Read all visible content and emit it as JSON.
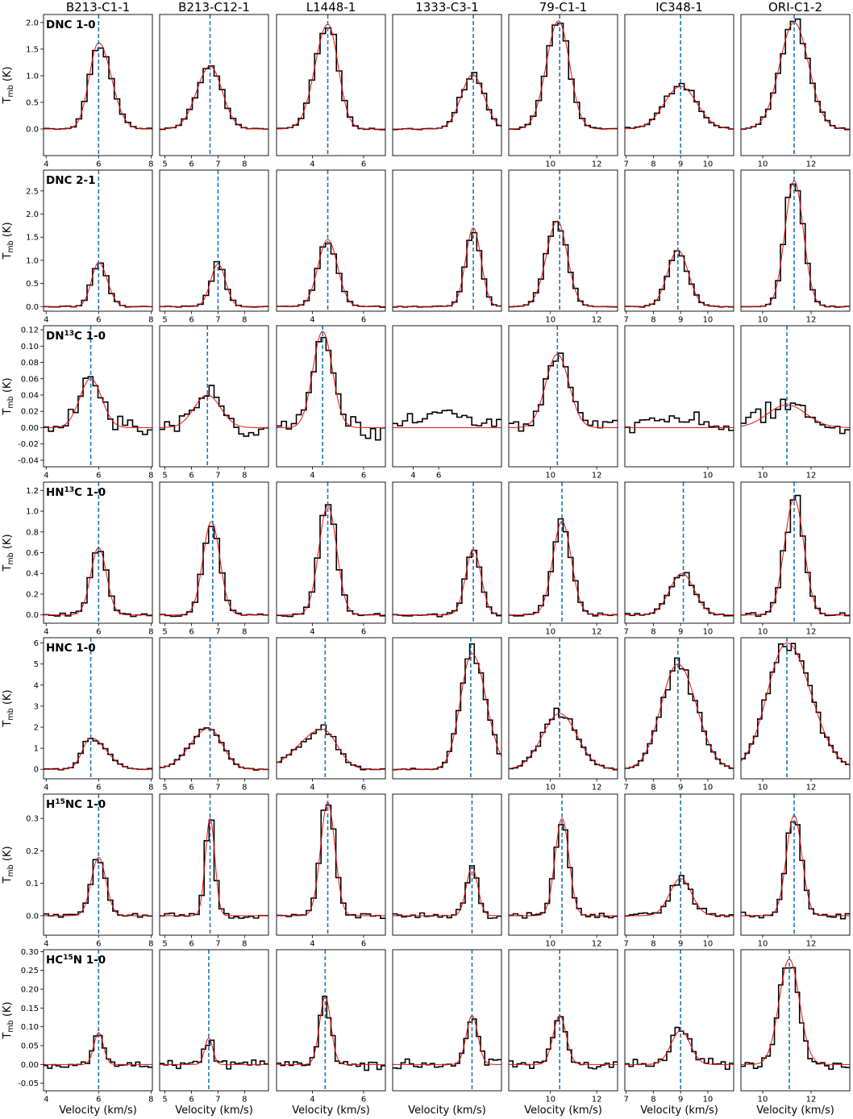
{
  "chart_data": {
    "type": "line",
    "xlabel": "Velocity (km/s)",
    "ylabel_main": "T",
    "ylabel_sub": "mb",
    "ylabel_unit": " (K)",
    "colors": {
      "observed": "#000000",
      "fit": "#e8120c",
      "vlsr": "#1f77b4"
    },
    "columns": [
      {
        "name": "B213-C1-1",
        "xlim": [
          3.9,
          8.05
        ],
        "xticks": [
          4,
          6,
          8
        ]
      },
      {
        "name": "B213-C12-1",
        "xlim": [
          4.8,
          8.9
        ],
        "xticks": [
          5,
          6,
          7,
          8
        ]
      },
      {
        "name": "L1448-1",
        "xlim": [
          2.6,
          6.85
        ],
        "xticks": [
          4,
          6
        ]
      },
      {
        "name": "1333-C3-1",
        "xlim": [
          2.4,
          10.9
        ],
        "xticks": [],
        "xticks_r5": [
          4,
          6
        ]
      },
      {
        "name": "79-C1-1",
        "xlim": [
          8.2,
          12.9
        ],
        "xticks": [
          10,
          12
        ]
      },
      {
        "name": "IC348-1",
        "xlim": [
          6.95,
          10.95
        ],
        "xticks": [
          7,
          8,
          9,
          10
        ],
        "xticks_r5": [
          10,
          12
        ]
      },
      {
        "name": "ORI-C1-2",
        "xlim": [
          9.1,
          13.6
        ],
        "xticks": [
          10,
          12
        ]
      }
    ],
    "rows": [
      {
        "line": "DNC 1-0",
        "pre": "DNC",
        "sup": "",
        "post": " 1-0",
        "ylim": [
          -0.5,
          2.15
        ],
        "yticks": [
          0.0,
          0.5,
          1.0,
          1.5,
          2.0
        ],
        "decimals": 1,
        "panels": [
          {
            "vlsr": 6.0,
            "amp": 1.62,
            "center": 6.0,
            "sigma": 0.42,
            "noise": 0.01,
            "bins": 20,
            "skew": -0.15
          },
          {
            "vlsr": 6.7,
            "amp": 1.18,
            "center": 6.7,
            "sigma": 0.48,
            "noise": 0.01,
            "bins": 20,
            "skew": 0.05
          },
          {
            "vlsr": 4.6,
            "amp": 1.97,
            "center": 4.6,
            "sigma": 0.45,
            "noise": 0.01,
            "bins": 20,
            "skew": 0.1
          },
          {
            "vlsr": 8.7,
            "amp": 1.02,
            "center": 8.65,
            "sigma": 0.9,
            "noise": 0.01,
            "bins": 22,
            "skew": 0.0
          },
          {
            "vlsr": 10.4,
            "amp": 2.03,
            "center": 10.35,
            "sigma": 0.5,
            "noise": 0.01,
            "bins": 20,
            "skew": 0.05
          },
          {
            "vlsr": 9.0,
            "amp": 0.8,
            "center": 9.0,
            "sigma": 0.6,
            "noise": 0.02,
            "bins": 22,
            "skew": 0.0
          },
          {
            "vlsr": 11.3,
            "amp": 2.0,
            "center": 11.3,
            "sigma": 0.6,
            "noise": 0.01,
            "bins": 22,
            "skew": 0.0
          }
        ]
      },
      {
        "line": "DNC 2-1",
        "pre": "DNC",
        "sup": "",
        "post": " 2-1",
        "ylim": [
          -0.1,
          2.95
        ],
        "yticks": [
          0.0,
          0.5,
          1.0,
          1.5,
          2.0,
          2.5
        ],
        "decimals": 1,
        "panels": [
          {
            "vlsr": 6.0,
            "amp": 0.95,
            "center": 6.0,
            "sigma": 0.3,
            "noise": 0.01,
            "bins": 20,
            "skew": -0.1
          },
          {
            "vlsr": 7.0,
            "amp": 0.92,
            "center": 7.0,
            "sigma": 0.28,
            "noise": 0.01,
            "bins": 20,
            "skew": 0.0
          },
          {
            "vlsr": 4.6,
            "amp": 1.45,
            "center": 4.6,
            "sigma": 0.38,
            "noise": 0.01,
            "bins": 20,
            "skew": 0.0
          },
          {
            "vlsr": 8.7,
            "amp": 1.7,
            "center": 8.7,
            "sigma": 0.6,
            "noise": 0.01,
            "bins": 22,
            "skew": 0.0
          },
          {
            "vlsr": 10.4,
            "amp": 1.85,
            "center": 10.3,
            "sigma": 0.45,
            "noise": 0.01,
            "bins": 22,
            "skew": 0.05
          },
          {
            "vlsr": 8.9,
            "amp": 1.22,
            "center": 8.9,
            "sigma": 0.38,
            "noise": 0.01,
            "bins": 22,
            "skew": 0.0
          },
          {
            "vlsr": 11.3,
            "amp": 2.72,
            "center": 11.3,
            "sigma": 0.38,
            "noise": 0.01,
            "bins": 22,
            "skew": 0.0
          }
        ]
      },
      {
        "line": "DN13C 1-0",
        "pre": "DN",
        "sup": "13",
        "post": "C 1-0",
        "ylim": [
          -0.048,
          0.125
        ],
        "yticks": [
          -0.04,
          -0.02,
          0.0,
          0.02,
          0.04,
          0.06,
          0.08,
          0.1,
          0.12
        ],
        "decimals": 2,
        "panels": [
          {
            "vlsr": 5.7,
            "amp": 0.06,
            "center": 5.7,
            "sigma": 0.42,
            "noise": 0.009,
            "bins": 22,
            "skew": 0.0
          },
          {
            "vlsr": 6.6,
            "amp": 0.04,
            "center": 6.6,
            "sigma": 0.5,
            "noise": 0.01,
            "bins": 22,
            "skew": 0.0
          },
          {
            "vlsr": 4.4,
            "amp": 0.118,
            "center": 4.4,
            "sigma": 0.38,
            "noise": 0.01,
            "bins": 22,
            "skew": 0.0
          },
          {
            "vlsr": null,
            "amp": 0.0,
            "center": 6.0,
            "sigma": 1.0,
            "noise": 0.008,
            "bins": 22,
            "skew": 0.0,
            "bump": 0.02
          },
          {
            "vlsr": 10.3,
            "amp": 0.09,
            "center": 10.3,
            "sigma": 0.5,
            "noise": 0.01,
            "bins": 22,
            "skew": 0.0
          },
          {
            "vlsr": null,
            "amp": 0.0,
            "center": 9.0,
            "sigma": 1.0,
            "noise": 0.008,
            "bins": 22,
            "skew": 0.0,
            "bump": 0.012
          },
          {
            "vlsr": 11.0,
            "amp": 0.028,
            "center": 11.0,
            "sigma": 0.8,
            "noise": 0.01,
            "bins": 22,
            "skew": 0.0
          }
        ]
      },
      {
        "line": "HN13C 1-0",
        "pre": "HN",
        "sup": "13",
        "post": "C 1-0",
        "ylim": [
          -0.08,
          1.28
        ],
        "yticks": [
          0.0,
          0.2,
          0.4,
          0.6,
          0.8,
          1.0,
          1.2
        ],
        "decimals": 1,
        "panels": [
          {
            "vlsr": 6.0,
            "amp": 0.65,
            "center": 6.0,
            "sigma": 0.3,
            "noise": 0.015,
            "bins": 20,
            "skew": 0.0
          },
          {
            "vlsr": 6.8,
            "amp": 0.9,
            "center": 6.75,
            "sigma": 0.32,
            "noise": 0.015,
            "bins": 20,
            "skew": 0.0
          },
          {
            "vlsr": 4.6,
            "amp": 1.05,
            "center": 4.6,
            "sigma": 0.35,
            "noise": 0.015,
            "bins": 20,
            "skew": 0.0
          },
          {
            "vlsr": 8.7,
            "amp": 0.63,
            "center": 8.7,
            "sigma": 0.6,
            "noise": 0.015,
            "bins": 22,
            "skew": 0.0
          },
          {
            "vlsr": 10.5,
            "amp": 0.9,
            "center": 10.5,
            "sigma": 0.4,
            "noise": 0.015,
            "bins": 22,
            "skew": 0.0
          },
          {
            "vlsr": 9.1,
            "amp": 0.4,
            "center": 9.05,
            "sigma": 0.45,
            "noise": 0.015,
            "bins": 22,
            "skew": 0.0
          },
          {
            "vlsr": 11.3,
            "amp": 1.12,
            "center": 11.3,
            "sigma": 0.4,
            "noise": 0.015,
            "bins": 22,
            "skew": 0.0
          }
        ]
      },
      {
        "line": "HNC 1-0",
        "pre": "HNC",
        "sup": "",
        "post": " 1-0",
        "ylim": [
          -0.45,
          6.25
        ],
        "yticks": [
          0,
          1,
          2,
          3,
          4,
          5,
          6
        ],
        "decimals": 0,
        "panels": [
          {
            "vlsr": 5.7,
            "amp": 1.5,
            "center": 5.7,
            "sigma": 0.45,
            "noise": 0.04,
            "bins": 22,
            "skew": -0.3
          },
          {
            "vlsr": 6.7,
            "amp": 1.95,
            "center": 6.65,
            "sigma": 0.6,
            "noise": 0.04,
            "bins": 22,
            "skew": 0.15
          },
          {
            "vlsr": 4.5,
            "amp": 1.9,
            "center": 4.4,
            "sigma": 0.75,
            "noise": 0.04,
            "bins": 22,
            "skew": 0.25
          },
          {
            "vlsr": 8.5,
            "amp": 5.5,
            "center": 8.6,
            "sigma": 1.0,
            "noise": 0.04,
            "bins": 24,
            "skew": -0.1
          },
          {
            "vlsr": 10.4,
            "amp": 2.65,
            "center": 10.4,
            "sigma": 0.75,
            "noise": 0.04,
            "bins": 24,
            "skew": 0.0
          },
          {
            "vlsr": 8.9,
            "amp": 5.0,
            "center": 8.9,
            "sigma": 0.65,
            "noise": 0.04,
            "bins": 24,
            "skew": -0.05
          },
          {
            "vlsr": 11.0,
            "amp": 6.0,
            "center": 11.0,
            "sigma": 0.9,
            "noise": 0.04,
            "bins": 26,
            "skew": -0.1
          }
        ]
      },
      {
        "line": "H15NC 1-0",
        "pre": "H",
        "sup": "15",
        "post": "NC 1-0",
        "ylim": [
          -0.06,
          0.375
        ],
        "yticks": [
          0.0,
          0.1,
          0.2,
          0.3
        ],
        "decimals": 1,
        "panels": [
          {
            "vlsr": 6.0,
            "amp": 0.18,
            "center": 6.0,
            "sigma": 0.28,
            "noise": 0.006,
            "bins": 22,
            "skew": 0.0
          },
          {
            "vlsr": 6.7,
            "amp": 0.3,
            "center": 6.7,
            "sigma": 0.18,
            "noise": 0.008,
            "bins": 22,
            "skew": 0.0
          },
          {
            "vlsr": 4.6,
            "amp": 0.35,
            "center": 4.6,
            "sigma": 0.28,
            "noise": 0.008,
            "bins": 22,
            "skew": 0.0
          },
          {
            "vlsr": 8.6,
            "amp": 0.15,
            "center": 8.6,
            "sigma": 0.45,
            "noise": 0.008,
            "bins": 24,
            "skew": 0.0
          },
          {
            "vlsr": 10.5,
            "amp": 0.3,
            "center": 10.5,
            "sigma": 0.3,
            "noise": 0.008,
            "bins": 24,
            "skew": 0.0
          },
          {
            "vlsr": 9.0,
            "amp": 0.115,
            "center": 9.0,
            "sigma": 0.4,
            "noise": 0.008,
            "bins": 24,
            "skew": 0.0
          },
          {
            "vlsr": 11.3,
            "amp": 0.31,
            "center": 11.3,
            "sigma": 0.32,
            "noise": 0.008,
            "bins": 24,
            "skew": 0.0
          }
        ]
      },
      {
        "line": "HC15N 1-0",
        "pre": "HC",
        "sup": "15",
        "post": "N 1-0",
        "ylim": [
          -0.07,
          0.305
        ],
        "yticks": [
          -0.05,
          0.0,
          0.05,
          0.1,
          0.15,
          0.2,
          0.25,
          0.3
        ],
        "decimals": 2,
        "panels": [
          {
            "vlsr": 6.0,
            "amp": 0.085,
            "center": 6.0,
            "sigma": 0.18,
            "noise": 0.009,
            "bins": 26,
            "skew": 0.0
          },
          {
            "vlsr": 6.65,
            "amp": 0.07,
            "center": 6.65,
            "sigma": 0.15,
            "noise": 0.01,
            "bins": 26,
            "skew": 0.0
          },
          {
            "vlsr": 4.5,
            "amp": 0.18,
            "center": 4.5,
            "sigma": 0.22,
            "noise": 0.012,
            "bins": 26,
            "skew": 0.0
          },
          {
            "vlsr": 8.6,
            "amp": 0.13,
            "center": 8.6,
            "sigma": 0.45,
            "noise": 0.01,
            "bins": 26,
            "skew": 0.0
          },
          {
            "vlsr": 10.4,
            "amp": 0.13,
            "center": 10.4,
            "sigma": 0.28,
            "noise": 0.01,
            "bins": 26,
            "skew": 0.0
          },
          {
            "vlsr": 9.0,
            "amp": 0.09,
            "center": 9.0,
            "sigma": 0.35,
            "noise": 0.012,
            "bins": 26,
            "skew": 0.0
          },
          {
            "vlsr": 11.1,
            "amp": 0.28,
            "center": 11.1,
            "sigma": 0.42,
            "noise": 0.012,
            "bins": 26,
            "skew": 0.0
          }
        ]
      }
    ]
  }
}
